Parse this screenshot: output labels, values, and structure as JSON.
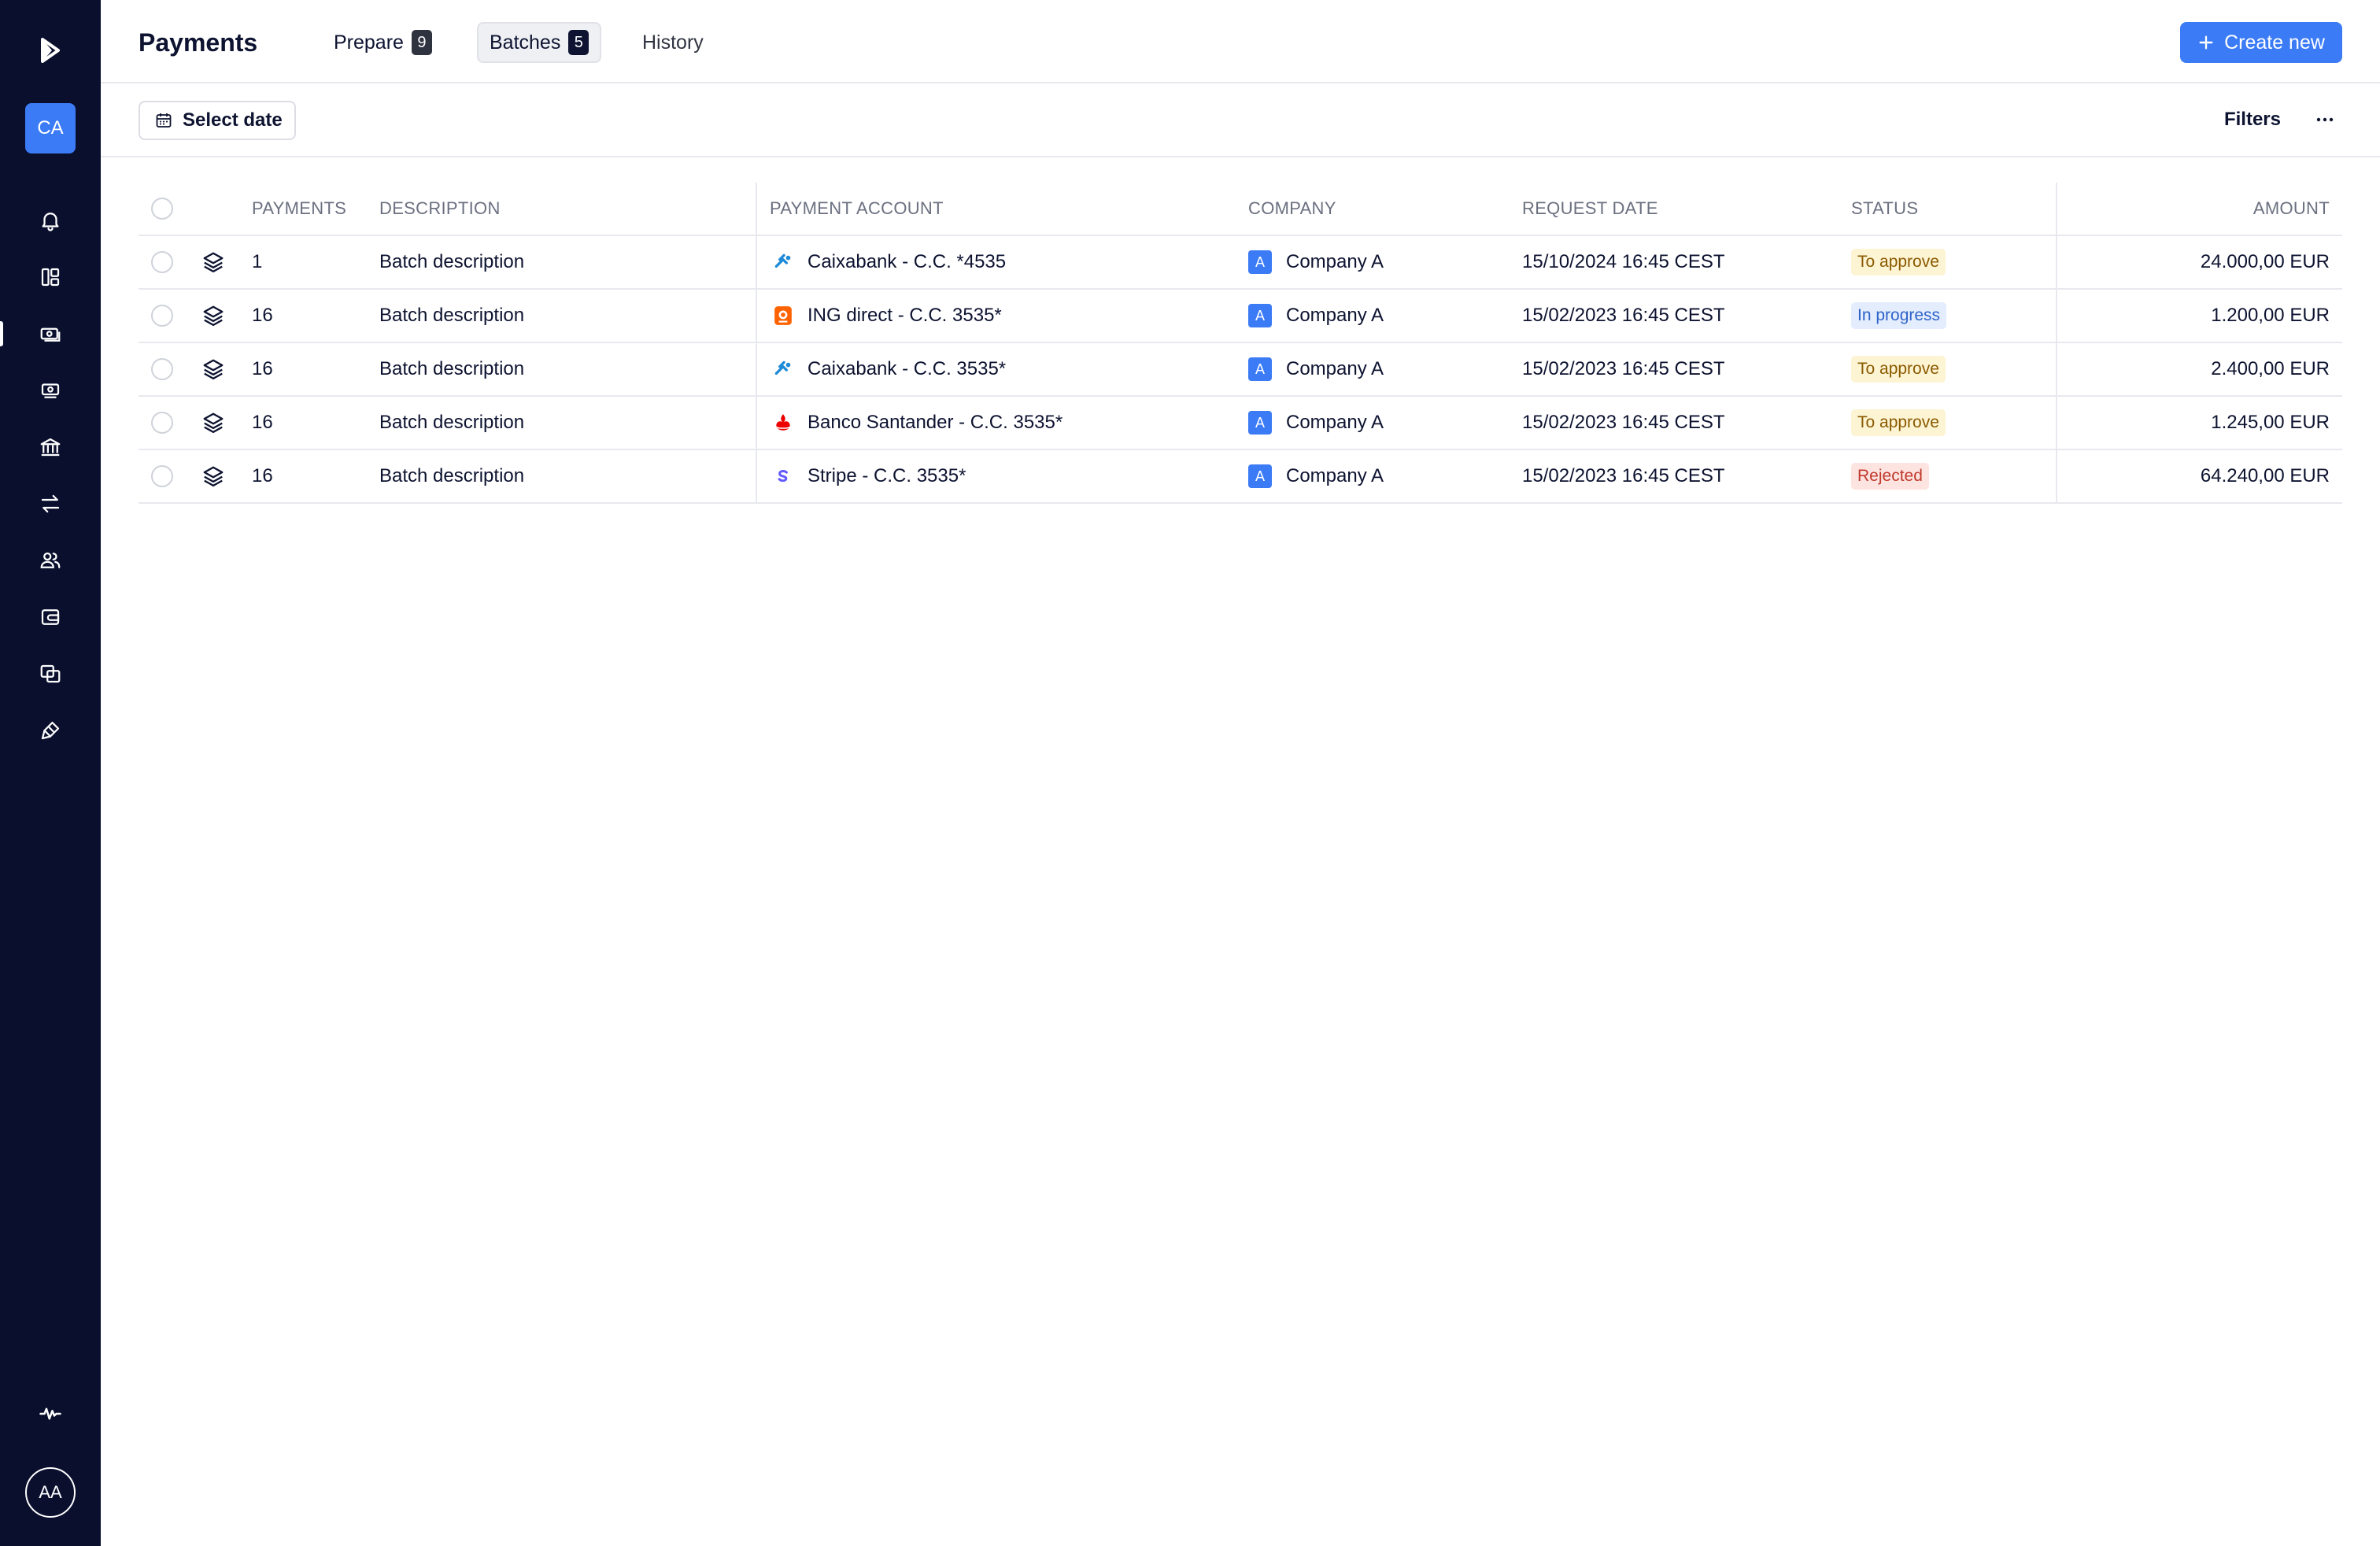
{
  "sidebar": {
    "org_initials": "CA",
    "user_initials": "AA",
    "nav": [
      {
        "icon": "bell-icon"
      },
      {
        "icon": "dashboard-icon"
      },
      {
        "icon": "payments-icon",
        "active": true
      },
      {
        "icon": "cash-icon"
      },
      {
        "icon": "bank-icon"
      },
      {
        "icon": "transfer-icon"
      },
      {
        "icon": "users-icon"
      },
      {
        "icon": "wallet-icon"
      },
      {
        "icon": "reconcile-icon"
      },
      {
        "icon": "integrations-icon"
      },
      {
        "icon": "activity-icon"
      }
    ]
  },
  "header": {
    "title": "Payments",
    "tabs": [
      {
        "label": "Prepare",
        "count": "9"
      },
      {
        "label": "Batches",
        "count": "5"
      },
      {
        "label": "History"
      }
    ],
    "create_label": "Create new"
  },
  "toolbar": {
    "date_label": "Select date",
    "filters_label": "Filters"
  },
  "table": {
    "headers": {
      "payments": "PAYMENTS",
      "description": "DESCRIPTION",
      "account": "PAYMENT ACCOUNT",
      "company": "COMPANY",
      "request_date": "REQUEST DATE",
      "status": "STATUS",
      "amount": "AMOUNT"
    },
    "rows": [
      {
        "payments": "1",
        "description": "Batch description",
        "bank": "caixabank",
        "account": "Caixabank - C.C. *4535",
        "company_initial": "A",
        "company": "Company A",
        "request_date": "15/10/2024 16:45 CEST",
        "status": "To approve",
        "status_kind": "approve",
        "amount": "24.000,00 EUR"
      },
      {
        "payments": "16",
        "description": "Batch description",
        "bank": "ing",
        "account": "ING direct - C.C. 3535*",
        "company_initial": "A",
        "company": "Company A",
        "request_date": "15/02/2023 16:45 CEST",
        "status": "In progress",
        "status_kind": "progress",
        "amount": "1.200,00 EUR"
      },
      {
        "payments": "16",
        "description": "Batch description",
        "bank": "caixabank",
        "account": "Caixabank - C.C. 3535*",
        "company_initial": "A",
        "company": "Company A",
        "request_date": "15/02/2023 16:45 CEST",
        "status": "To approve",
        "status_kind": "approve",
        "amount": "2.400,00 EUR"
      },
      {
        "payments": "16",
        "description": "Batch description",
        "bank": "santander",
        "account": "Banco Santander - C.C. 3535*",
        "company_initial": "A",
        "company": "Company A",
        "request_date": "15/02/2023 16:45 CEST",
        "status": "To approve",
        "status_kind": "approve",
        "amount": "1.245,00 EUR"
      },
      {
        "payments": "16",
        "description": "Batch description",
        "bank": "stripe",
        "account": "Stripe - C.C. 3535*",
        "company_initial": "A",
        "company": "Company A",
        "request_date": "15/02/2023 16:45 CEST",
        "status": "Rejected",
        "status_kind": "rejected",
        "amount": "64.240,00 EUR"
      }
    ]
  },
  "colors": {
    "sidebar_bg": "#0a0f2e",
    "accent": "#3b7bf6",
    "caixabank": "#1d8ad8",
    "ing": "#ff6200",
    "santander": "#ec0000",
    "stripe": "#635bff"
  }
}
